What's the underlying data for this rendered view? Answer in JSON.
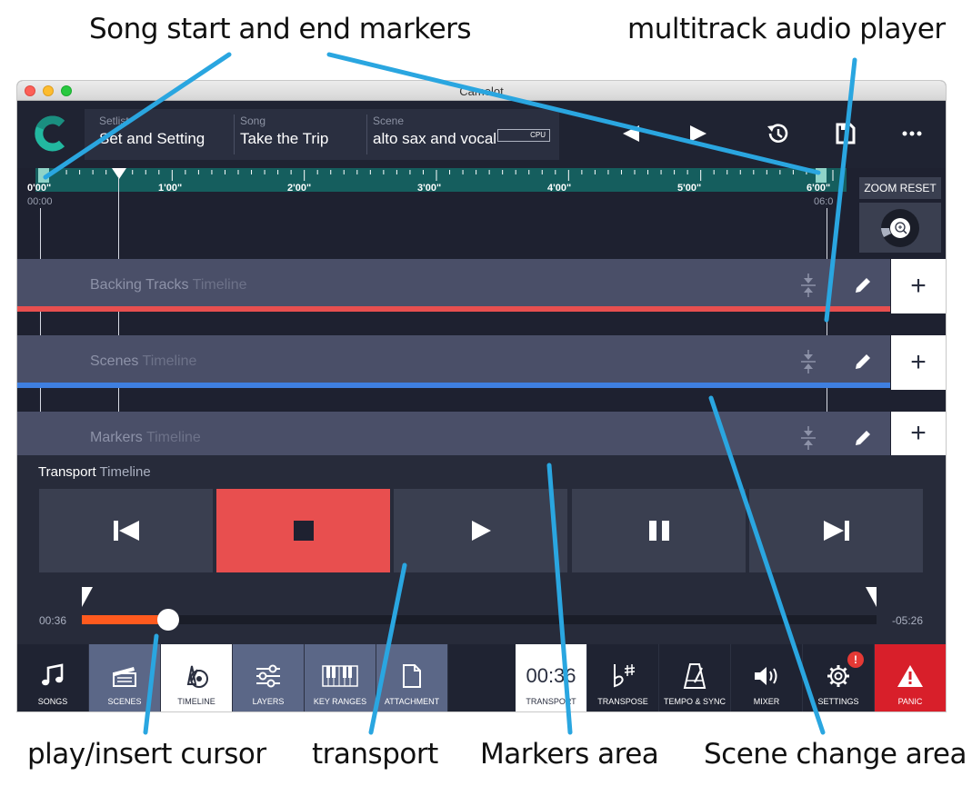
{
  "callouts": {
    "song_markers": "Song start and end markers",
    "multitrack": "multitrack audio player",
    "play_cursor": "play/insert cursor",
    "transport": "transport",
    "markers_area": "Markers area",
    "scene_change": "Scene change area"
  },
  "window": {
    "title": "Camelot"
  },
  "header": {
    "setlist_label": "Setlist",
    "setlist_value": "Set and Setting",
    "song_label": "Song",
    "song_value": "Take the Trip",
    "scene_label": "Scene",
    "scene_value": "alto sax and vocal",
    "cpu_label": "CPU"
  },
  "timeline": {
    "ticks": [
      "0'00\"",
      "1'00\"",
      "2'00\"",
      "3'00\"",
      "4'00\"",
      "5'00\"",
      "6'00\""
    ],
    "start_time": "00:00",
    "end_time": "06:0",
    "zoom_reset": "ZOOM RESET"
  },
  "tracks": [
    {
      "name": "Backing Tracks",
      "type": "Timeline",
      "color": "#e84f4f"
    },
    {
      "name": "Scenes",
      "type": "Timeline",
      "color": "#3f7fe0"
    },
    {
      "name": "Markers",
      "type": "Timeline"
    }
  ],
  "transport": {
    "name": "Transport",
    "type": "Timeline",
    "elapsed": "00:36",
    "remaining": "-05:26",
    "progress": 0.1
  },
  "bottom": {
    "songs": "SONGS",
    "scenes": "SCENES",
    "timeline": "TIMELINE",
    "layers": "LAYERS",
    "key_ranges": "KEY RANGES",
    "attachment": "ATTACHMENT",
    "transport_time": "00:36",
    "transport": "TRANSPORT",
    "transpose": "TRANSPOSE",
    "tempo_sync": "TEMPO & SYNC",
    "mixer": "MIXER",
    "settings": "SETTINGS",
    "settings_badge": "!",
    "panic": "PANIC"
  },
  "colors": {
    "accent_teal": "#155e5e",
    "stop_red": "#e84f4f",
    "annotation_blue": "#2aa6e0",
    "progress_orange": "#ff5a1e",
    "panic_red": "#d81f2a"
  }
}
